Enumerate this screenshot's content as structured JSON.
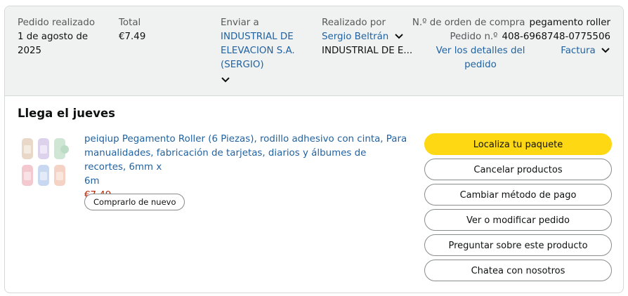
{
  "header": {
    "placed": {
      "label": "Pedido realizado",
      "value_line1": "1 de agosto de",
      "value_line2": "2025"
    },
    "total": {
      "label": "Total",
      "value": "€7.49"
    },
    "ship_to": {
      "label": "Enviar a",
      "line1": "INDUSTRIAL DE",
      "line2": "ELEVACION S.A.",
      "line3": "(SERGIO)"
    },
    "placed_by": {
      "label": "Realizado por",
      "name": "Sergio Beltrán",
      "company": "INDUSTRIAL DE E..."
    },
    "po": {
      "label": "N.º de orden de compra",
      "value": "pegamento roller"
    },
    "order_number": {
      "label": "Pedido n.º",
      "value": "408-6968748-0775506"
    },
    "details_link_line1": "Ver los detalles del",
    "details_link_line2": "pedido",
    "invoice_label": "Factura"
  },
  "delivery": {
    "title": "Llega el jueves"
  },
  "product": {
    "title_line1": "peiqiup Pegamento Roller (6 Piezas), rodillo adhesivo con cinta, Para",
    "title_line2": "manualidades, fabricación de tarjetas, diarios y álbumes de recortes, 6mm x",
    "title_line3": "6m",
    "price": "€7.49",
    "buy_again_label": "Comprarlo de nuevo"
  },
  "actions": {
    "track": "Localiza tu paquete",
    "cancel": "Cancelar productos",
    "change_payment": "Cambiar método de pago",
    "view_edit": "Ver o modificar pedido",
    "ask": "Preguntar sobre este producto",
    "chat": "Chatea con nosotros"
  },
  "colors": {
    "accent_button": "#ffd814",
    "link": "#2162a1",
    "price": "#b12704",
    "header_bg": "#f0f2f2"
  }
}
